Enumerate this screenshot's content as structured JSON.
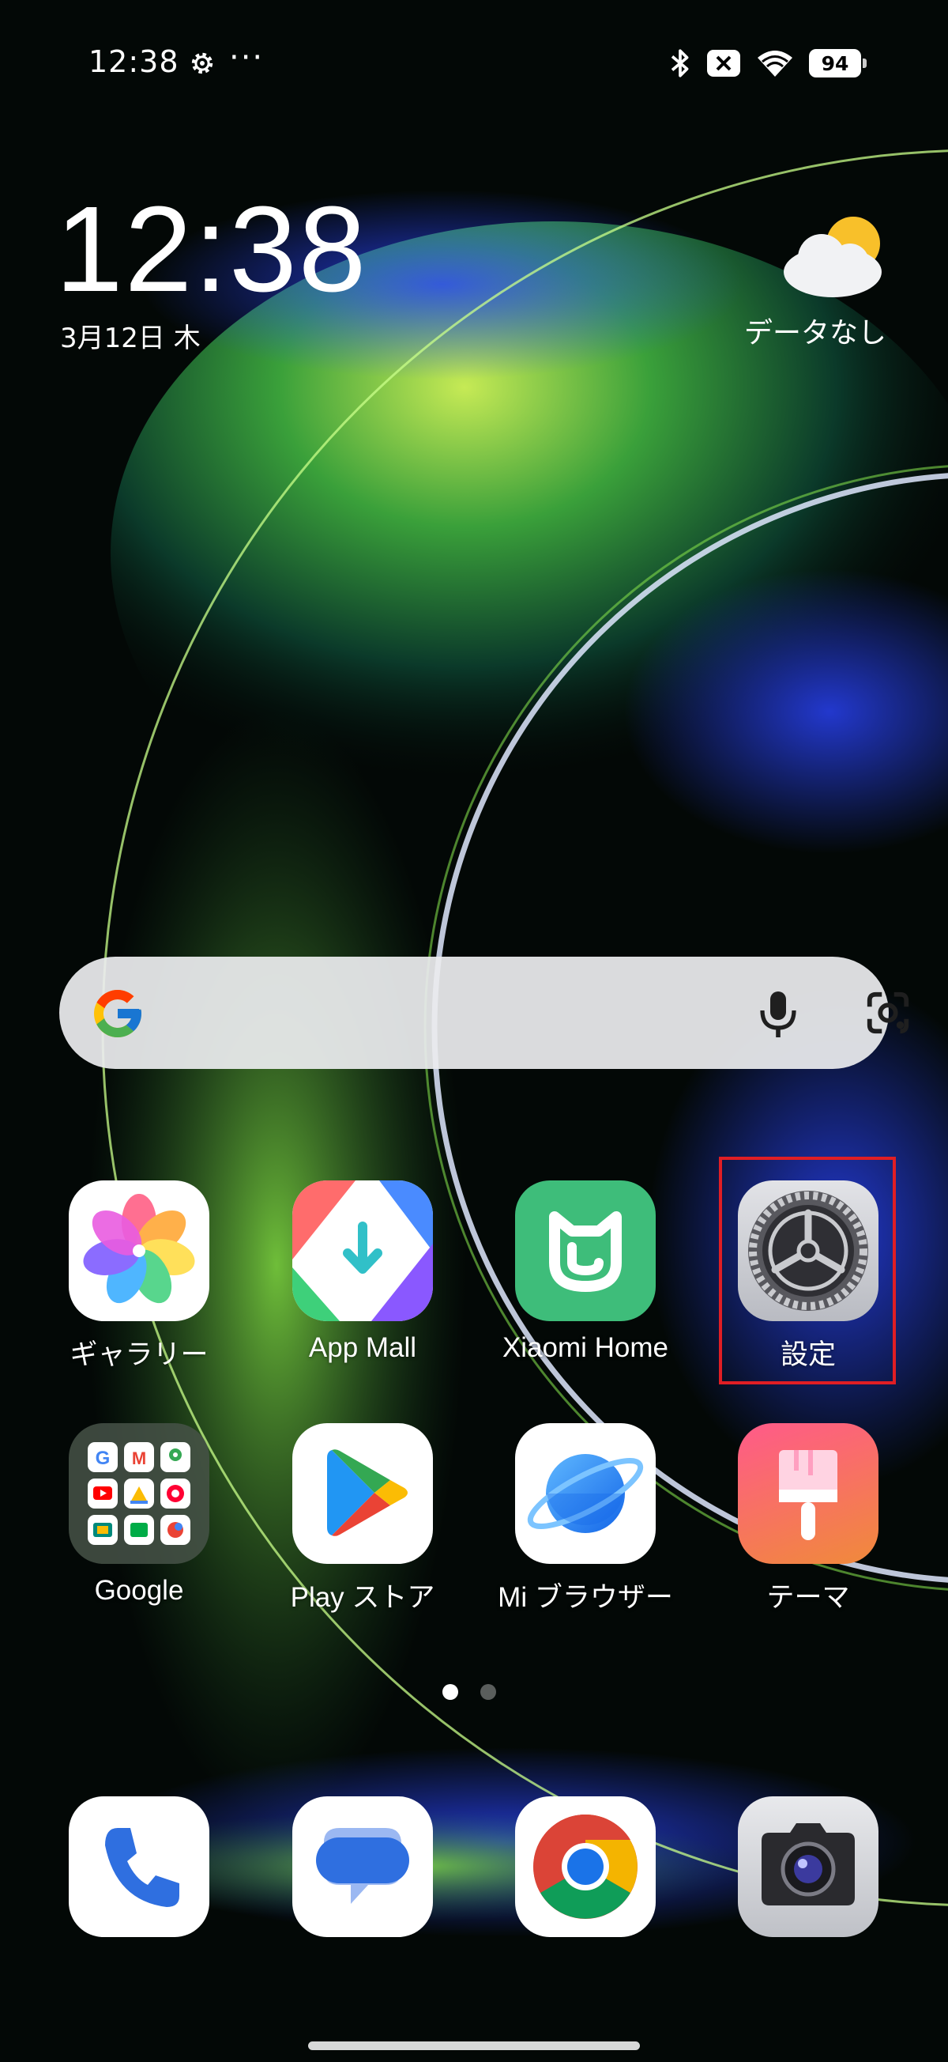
{
  "status_bar": {
    "time": "12:38",
    "more_indicator": "···",
    "battery_level": "94",
    "icons": [
      "gear-icon",
      "bluetooth-icon",
      "sim-off-icon",
      "wifi-icon",
      "battery-icon"
    ]
  },
  "clock_widget": {
    "time": "12:38",
    "date": "3月12日 木"
  },
  "weather_widget": {
    "icon": "partly-cloudy-icon",
    "text": "データなし"
  },
  "search_bar": {
    "icons": [
      "google-g-icon",
      "microphone-icon",
      "google-lens-icon"
    ]
  },
  "apps_row1": [
    {
      "label": "ギャラリー",
      "icon": "gallery-icon"
    },
    {
      "label": "App Mall",
      "icon": "app-mall-icon"
    },
    {
      "label": "Xiaomi Home",
      "icon": "xiaomi-home-icon"
    },
    {
      "label": "設定",
      "icon": "settings-icon",
      "highlighted": true
    }
  ],
  "apps_row2": [
    {
      "label": "Google",
      "icon": "google-folder-icon"
    },
    {
      "label": "Play ストア",
      "icon": "play-store-icon"
    },
    {
      "label": "Mi ブラウザー",
      "icon": "mi-browser-icon"
    },
    {
      "label": "テーマ",
      "icon": "themes-icon"
    }
  ],
  "page_indicator": {
    "current": 1,
    "total": 2
  },
  "dock": [
    {
      "icon": "phone-icon"
    },
    {
      "icon": "messages-icon"
    },
    {
      "icon": "chrome-icon"
    },
    {
      "icon": "camera-icon"
    }
  ],
  "colors": {
    "highlight_border": "#e01e24",
    "search_bar_bg": "#ebeced"
  }
}
